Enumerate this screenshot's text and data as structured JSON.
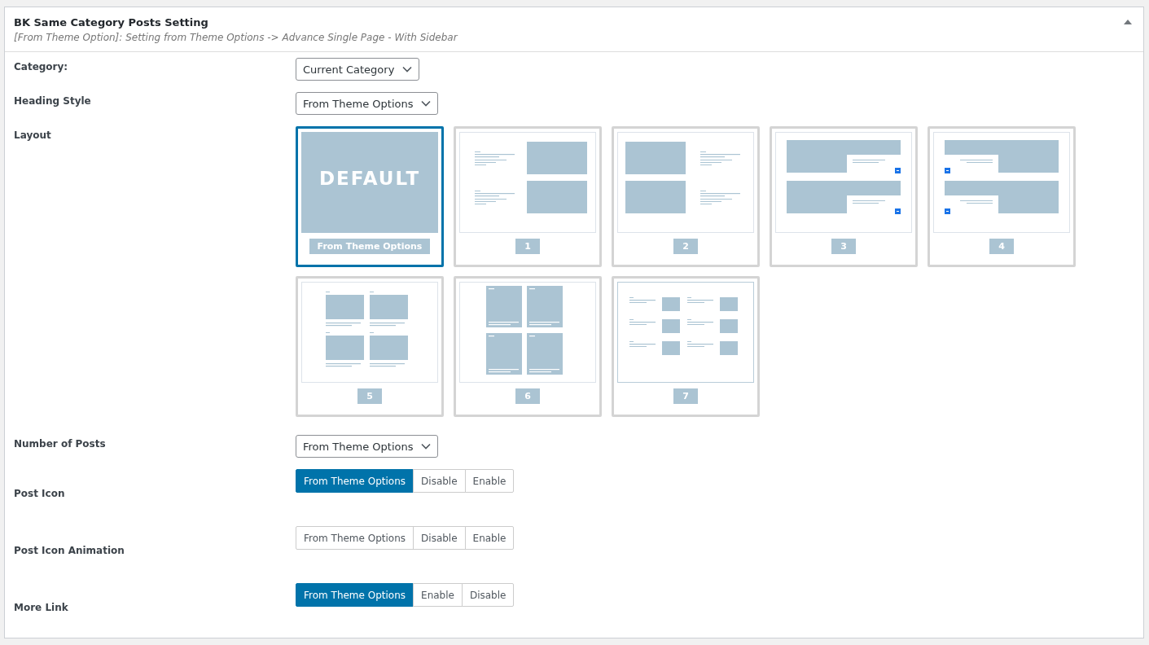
{
  "panel": {
    "title": "BK Same Category Posts Setting",
    "subtitle": "[From Theme Option]: Setting from Theme Options -> Advance Single Page - With Sidebar",
    "expanded": true
  },
  "fields": [
    {
      "kind": "select",
      "label": "Category:",
      "value": "Current Category"
    },
    {
      "kind": "select",
      "label": "Heading Style",
      "value": "From Theme Options"
    },
    {
      "kind": "layout",
      "label": "Layout",
      "options": [
        {
          "kind": "default",
          "title": "DEFAULT",
          "label": "From Theme Options",
          "selected": true
        },
        {
          "kind": "media-right",
          "label": "1",
          "selected": false
        },
        {
          "kind": "media-left",
          "label": "2",
          "selected": false
        },
        {
          "kind": "overlay-right",
          "label": "3",
          "selected": false
        },
        {
          "kind": "overlay-left",
          "label": "4",
          "selected": false
        },
        {
          "kind": "grid",
          "label": "5",
          "selected": false
        },
        {
          "kind": "tall-grid",
          "label": "6",
          "selected": false
        },
        {
          "kind": "small-grid",
          "label": "7",
          "selected": false
        }
      ]
    },
    {
      "kind": "select",
      "label": "Number of Posts",
      "value": "From Theme Options"
    },
    {
      "kind": "buttonset",
      "label": "Post Icon",
      "options": [
        {
          "label": "From Theme Options",
          "selected": true
        },
        {
          "label": "Disable",
          "selected": false
        },
        {
          "label": "Enable",
          "selected": false
        }
      ]
    },
    {
      "kind": "buttonset",
      "label": "Post Icon Animation",
      "options": [
        {
          "label": "From Theme Options",
          "selected": false
        },
        {
          "label": "Disable",
          "selected": false
        },
        {
          "label": "Enable",
          "selected": false
        }
      ]
    },
    {
      "kind": "buttonset",
      "label": "More Link",
      "options": [
        {
          "label": "From Theme Options",
          "selected": true
        },
        {
          "label": "Enable",
          "selected": false
        },
        {
          "label": "Disable",
          "selected": false
        }
      ]
    }
  ]
}
